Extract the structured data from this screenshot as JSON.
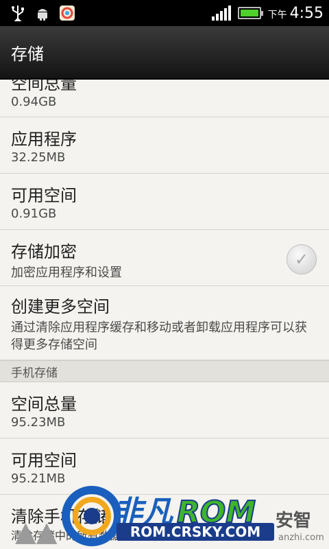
{
  "status_bar": {
    "icons": [
      "usb-icon",
      "android-debug-icon",
      "app-store-icon"
    ],
    "signal_bars": 5,
    "battery_level": 1.0,
    "am_pm": "下午",
    "time": "4:55"
  },
  "header": {
    "title": "存储"
  },
  "rows": [
    {
      "label": "空间总量",
      "value": "0.94GB"
    },
    {
      "label": "应用程序",
      "value": "32.25MB"
    },
    {
      "label": "可用空间",
      "value": "0.91GB"
    },
    {
      "label": "存储加密",
      "value": "加密应用程序和设置",
      "checked": false
    },
    {
      "label": "创建更多空间",
      "value": "通过清除应用程序缓存和移动或者卸载应用程序可以获得更多存储空间"
    }
  ],
  "phone_section": {
    "header": "手机存储",
    "rows": [
      {
        "label": "空间总量",
        "value": "95.23MB"
      },
      {
        "label": "可用空间",
        "value": "95.21MB"
      },
      {
        "label": "清除手机存储",
        "value": "清除存储中的所有数据，例如音乐和照片"
      }
    ]
  },
  "watermark": {
    "brand_text": "非凡",
    "brand_rom": "ROM",
    "url": "ROM.CRSKY.COM",
    "partner": "安智",
    "partner_sub": "anzhi.com"
  },
  "colors": {
    "battery": "#4fd02a",
    "brand_blue": "#1a5fbd",
    "brand_green": "#3fb52a"
  }
}
